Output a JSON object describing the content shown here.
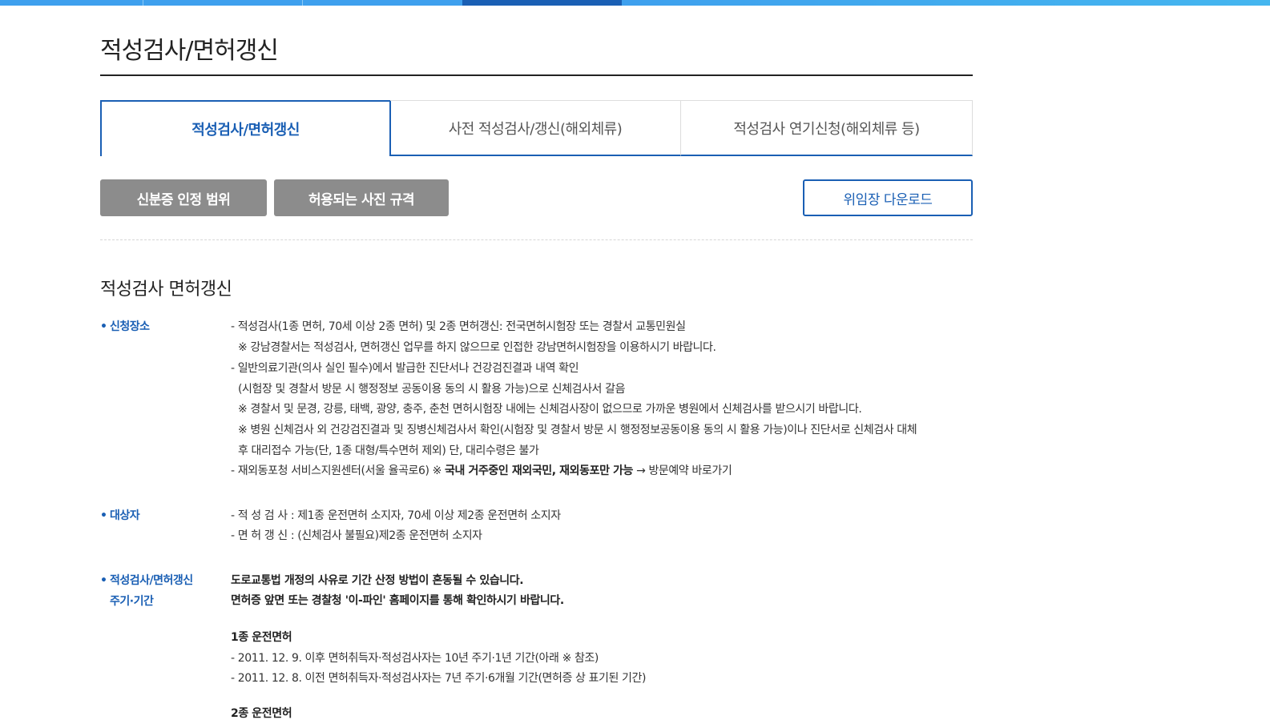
{
  "header": {
    "page_title": "적성검사/면허갱신"
  },
  "tabs": [
    {
      "label": "적성검사/면허갱신",
      "active": true
    },
    {
      "label": "사전 적성검사/갱신(해외체류)",
      "active": false
    },
    {
      "label": "적성검사 연기신청(해외체류 등)",
      "active": false
    }
  ],
  "buttons": {
    "id_range": "신분증 인정 범위",
    "photo_spec": "허용되는 사진 규격",
    "proxy_download": "위임장 다운로드"
  },
  "section": {
    "title": "적성검사 면허갱신",
    "place": {
      "label": "신청장소",
      "lines": [
        "- 적성검사(1종 면허, 70세 이상 2종 면허) 및 2종 면허갱신: 전국면허시험장 또는 경찰서 교통민원실",
        "※ 강남경찰서는 적성검사, 면허갱신 업무를 하지 않으므로 인접한 강남면허시험장을 이용하시기 바랍니다.",
        "- 일반의료기관(의사 실인 필수)에서 발급한 진단서나 건강검진결과 내역 확인",
        "(시험장 및 경찰서 방문 시 행정정보 공동이용 동의 시 활용 가능)으로 신체검사서 갈음",
        "※ 경찰서 및 문경, 강릉, 태백, 광양, 충주, 춘천 면허시험장 내에는 신체검사장이 없으므로 가까운 병원에서 신체검사를 받으시기 바랍니다.",
        "※ 병원 신체검사 외 건강검진결과 및 징병신체검사서 확인(시험장 및 경찰서 방문 시 행정정보공동이용 동의 시 활용 가능)이나 진단서로 신체검사 대체",
        "후 대리접수 가능(단, 1종 대형/특수면허 제외) 단, 대리수령은 불가"
      ],
      "overseas_prefix": "- 재외동포청 서비스지원센터(서울 율곡로6) ※ ",
      "overseas_bold": "국내 거주중인 재외국민, 재외동포만 가능",
      "overseas_arrow": " → ",
      "overseas_link": "방문예약 바로가기"
    },
    "target": {
      "label": "대상자",
      "lines": [
        "- 적 성 검 사 : 제1종 운전면허 소지자, 70세 이상 제2종 운전면허 소지자",
        "- 면 허 갱 신 : (신체검사 불필요)제2종 운전면허 소지자"
      ]
    },
    "period": {
      "label_line1": "적성검사/면허갱신",
      "label_line2": "주기·기간",
      "notice1": "도로교통법 개정의 사유로 기간 산정 방법이 혼동될 수 있습니다.",
      "notice2": "면허증 앞면 또는 경찰청 '이-파인' 홈페이지를 통해 확인하시기 바랍니다.",
      "class1_title": "1종 운전면허",
      "class1_lines": [
        "- 2011. 12. 9. 이후 면허취득자·적성검사자는 10년 주기·1년 기간(아래 ※ 참조)",
        "- 2011. 12. 8. 이전 면허취득자·적성검사자는 7년 주기·6개월 기간(면허증 상 표기된 기간)"
      ],
      "class2_title": "2종 운전면허"
    }
  },
  "colors": {
    "accent": "#1a5fb4",
    "topbar": "#3ea0ee",
    "button_gray": "#8c8c8c"
  }
}
